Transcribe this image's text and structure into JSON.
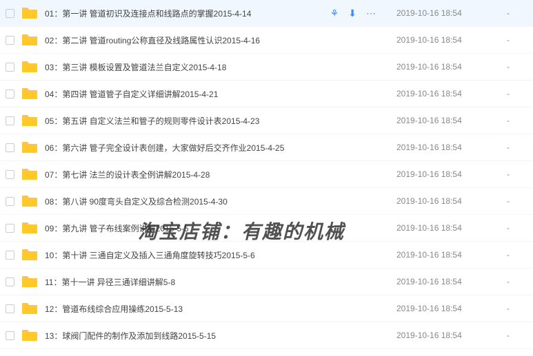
{
  "watermark": "淘宝店铺：有趣的机械",
  "actions": {
    "share": "⚘",
    "download": "⬇",
    "more": "⋯"
  },
  "placeholder_dash": "-",
  "files": [
    {
      "name": "01：第一讲 管道初识及连接点和线路点的掌握2015-4-14",
      "date": "2019-10-16 18:54",
      "selected": true
    },
    {
      "name": "02：第二讲 管道routing公称直径及线路属性认识2015-4-16",
      "date": "2019-10-16 18:54",
      "selected": false
    },
    {
      "name": "03：第三讲 模板设置及管道法兰自定义2015-4-18",
      "date": "2019-10-16 18:54",
      "selected": false
    },
    {
      "name": "04：第四讲 管道管子自定义详细讲解2015-4-21",
      "date": "2019-10-16 18:54",
      "selected": false
    },
    {
      "name": "05：第五讲 自定义法兰和管子的规则零件设计表2015-4-23",
      "date": "2019-10-16 18:54",
      "selected": false
    },
    {
      "name": "06：第六讲 管子完全设计表创建，大家做好后交齐作业2015-4-25",
      "date": "2019-10-16 18:54",
      "selected": false
    },
    {
      "name": "07：第七讲 法兰的设计表全例讲解2015-4-28",
      "date": "2019-10-16 18:54",
      "selected": false
    },
    {
      "name": "08：第八讲 90度弯头自定义及综合检测2015-4-30",
      "date": "2019-10-16 18:54",
      "selected": false
    },
    {
      "name": "09：第九讲 管子布线案例讲解2015-5-5",
      "date": "2019-10-16 18:54",
      "selected": false
    },
    {
      "name": "10：第十讲 三通自定义及插入三通角度旋转技巧2015-5-6",
      "date": "2019-10-16 18:54",
      "selected": false
    },
    {
      "name": "11：第十一讲 异径三通详细讲解5-8",
      "date": "2019-10-16 18:54",
      "selected": false
    },
    {
      "name": "12：管道布线综合应用操练2015-5-13",
      "date": "2019-10-16 18:54",
      "selected": false
    },
    {
      "name": "13：球阀门配件的制作及添加到线路2015-5-15",
      "date": "2019-10-16 18:54",
      "selected": false
    }
  ]
}
